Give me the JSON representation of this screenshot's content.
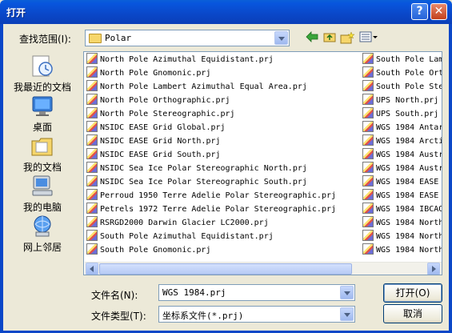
{
  "window": {
    "title": "打开",
    "help_label": "?",
    "close_label": "✕"
  },
  "lookin": {
    "label": "查找范围(I):",
    "value": "Polar"
  },
  "places": [
    {
      "label": "我最近的文档",
      "icon": "recent-documents-icon"
    },
    {
      "label": "桌面",
      "icon": "desktop-icon"
    },
    {
      "label": "我的文档",
      "icon": "my-documents-icon"
    },
    {
      "label": "我的电脑",
      "icon": "my-computer-icon"
    },
    {
      "label": "网上邻居",
      "icon": "network-places-icon"
    }
  ],
  "files_col1": [
    "North Pole Azimuthal Equidistant.prj",
    "North Pole Gnomonic.prj",
    "North Pole Lambert Azimuthal Equal Area.prj",
    "North Pole Orthographic.prj",
    "North Pole Stereographic.prj",
    "NSIDC EASE Grid Global.prj",
    "NSIDC EASE Grid North.prj",
    "NSIDC EASE Grid South.prj",
    "NSIDC Sea Ice Polar Stereographic North.prj",
    "NSIDC Sea Ice Polar Stereographic South.prj",
    "Perroud 1950 Terre Adelie Polar Stereographic.prj",
    "Petrels 1972 Terre Adelie Polar Stereographic.prj",
    "RSRGD2000 Darwin Glacier LC2000.prj",
    "South Pole Azimuthal Equidistant.prj",
    "South Pole Gnomonic.prj"
  ],
  "files_col2": [
    "South Pole Lam",
    "South Pole Ort",
    "South Pole Ste",
    "UPS North.prj",
    "UPS South.prj",
    "WGS 1984 Antar",
    "WGS 1984 Arcti",
    "WGS 1984 Austr",
    "WGS 1984 Austr",
    "WGS 1984 EASE",
    "WGS 1984 EASE",
    "WGS 1984 IBCAO",
    "WGS 1984 North",
    "WGS 1984 North",
    "WGS 1984 North"
  ],
  "filename": {
    "label": "文件名(N):",
    "value": "WGS 1984.prj"
  },
  "filetype": {
    "label": "文件类型(T):",
    "value": "坐标系文件(*.prj)"
  },
  "buttons": {
    "open": "打开(O)",
    "cancel": "取消"
  }
}
